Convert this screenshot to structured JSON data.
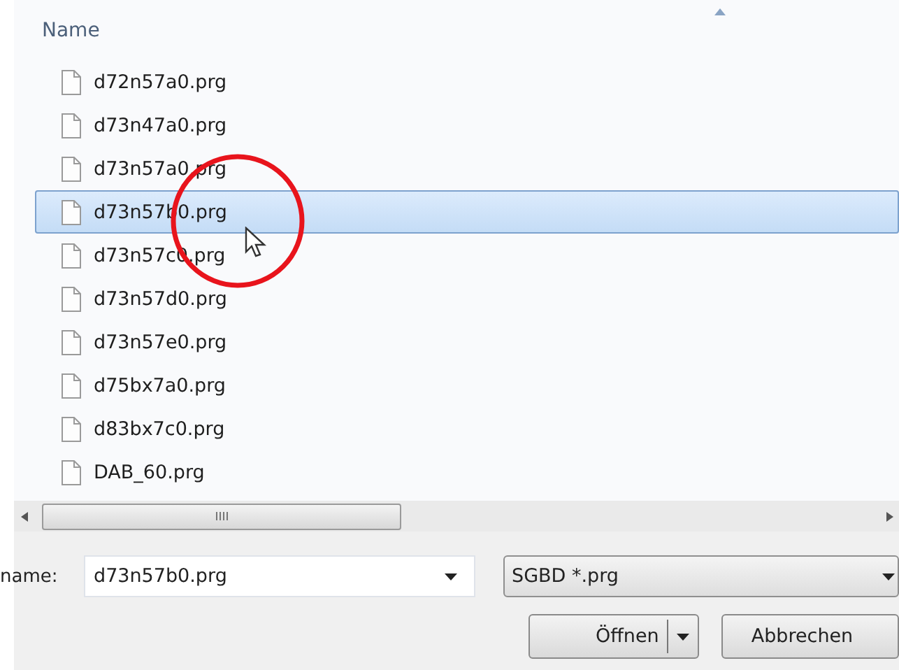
{
  "list": {
    "column_header": "Name",
    "files": [
      {
        "name": "d72n57a0.prg",
        "selected": false
      },
      {
        "name": "d73n47a0.prg",
        "selected": false
      },
      {
        "name": "d73n57a0.prg",
        "selected": false
      },
      {
        "name": "d73n57b0.prg",
        "selected": true
      },
      {
        "name": "d73n57c0.prg",
        "selected": false
      },
      {
        "name": "d73n57d0.prg",
        "selected": false
      },
      {
        "name": "d73n57e0.prg",
        "selected": false
      },
      {
        "name": "d75bx7a0.prg",
        "selected": false
      },
      {
        "name": "d83bx7c0.prg",
        "selected": false
      },
      {
        "name": "DAB_60.prg",
        "selected": false
      }
    ]
  },
  "filename": {
    "label": "name:",
    "value": "d73n57b0.prg"
  },
  "filter": {
    "value": "SGBD *.prg"
  },
  "buttons": {
    "open": "Öffnen",
    "cancel": "Abbrechen"
  }
}
